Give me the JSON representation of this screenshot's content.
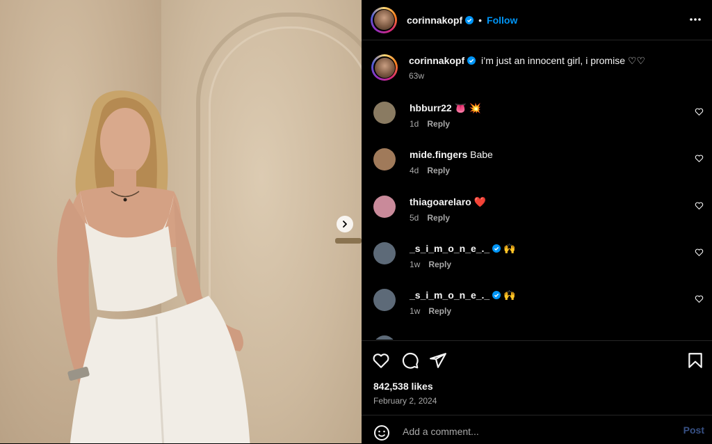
{
  "post": {
    "author": "corinnakopf",
    "follow_label": "Follow",
    "separator": "•",
    "caption": "i’m just an innocent girl, i promise ♡♡",
    "caption_time": "63w"
  },
  "comments": [
    {
      "user": "hbburr22",
      "text": "👅 💥",
      "time": "1d",
      "reply": "Reply",
      "verified": false,
      "avatar_color": "#8a7b62"
    },
    {
      "user": "mide.fingers",
      "text": "Babe",
      "time": "4d",
      "reply": "Reply",
      "verified": false,
      "avatar_color": "#a07a5a"
    },
    {
      "user": "thiagoarelaro",
      "text": "❤️",
      "time": "5d",
      "reply": "Reply",
      "verified": false,
      "avatar_color": "#c98a9a"
    },
    {
      "user": "_s_i_m_o_n_e_._",
      "text": "🙌",
      "time": "1w",
      "reply": "Reply",
      "verified": true,
      "avatar_color": "#5d6a78"
    },
    {
      "user": "_s_i_m_o_n_e_._",
      "text": "🙌",
      "time": "1w",
      "reply": "Reply",
      "verified": true,
      "avatar_color": "#5d6a78"
    }
  ],
  "actions": {
    "likes": "842,538 likes",
    "date": "February 2, 2024"
  },
  "composer": {
    "placeholder": "Add a comment...",
    "post_label": "Post"
  },
  "colors": {
    "accent": "#0095f6",
    "background": "#000000",
    "muted_text": "#a8a8a8"
  },
  "icons": [
    "chevron-right-icon",
    "more-icon",
    "verified-icon",
    "heart-icon",
    "comment-icon",
    "share-icon",
    "bookmark-icon",
    "emoji-icon"
  ]
}
